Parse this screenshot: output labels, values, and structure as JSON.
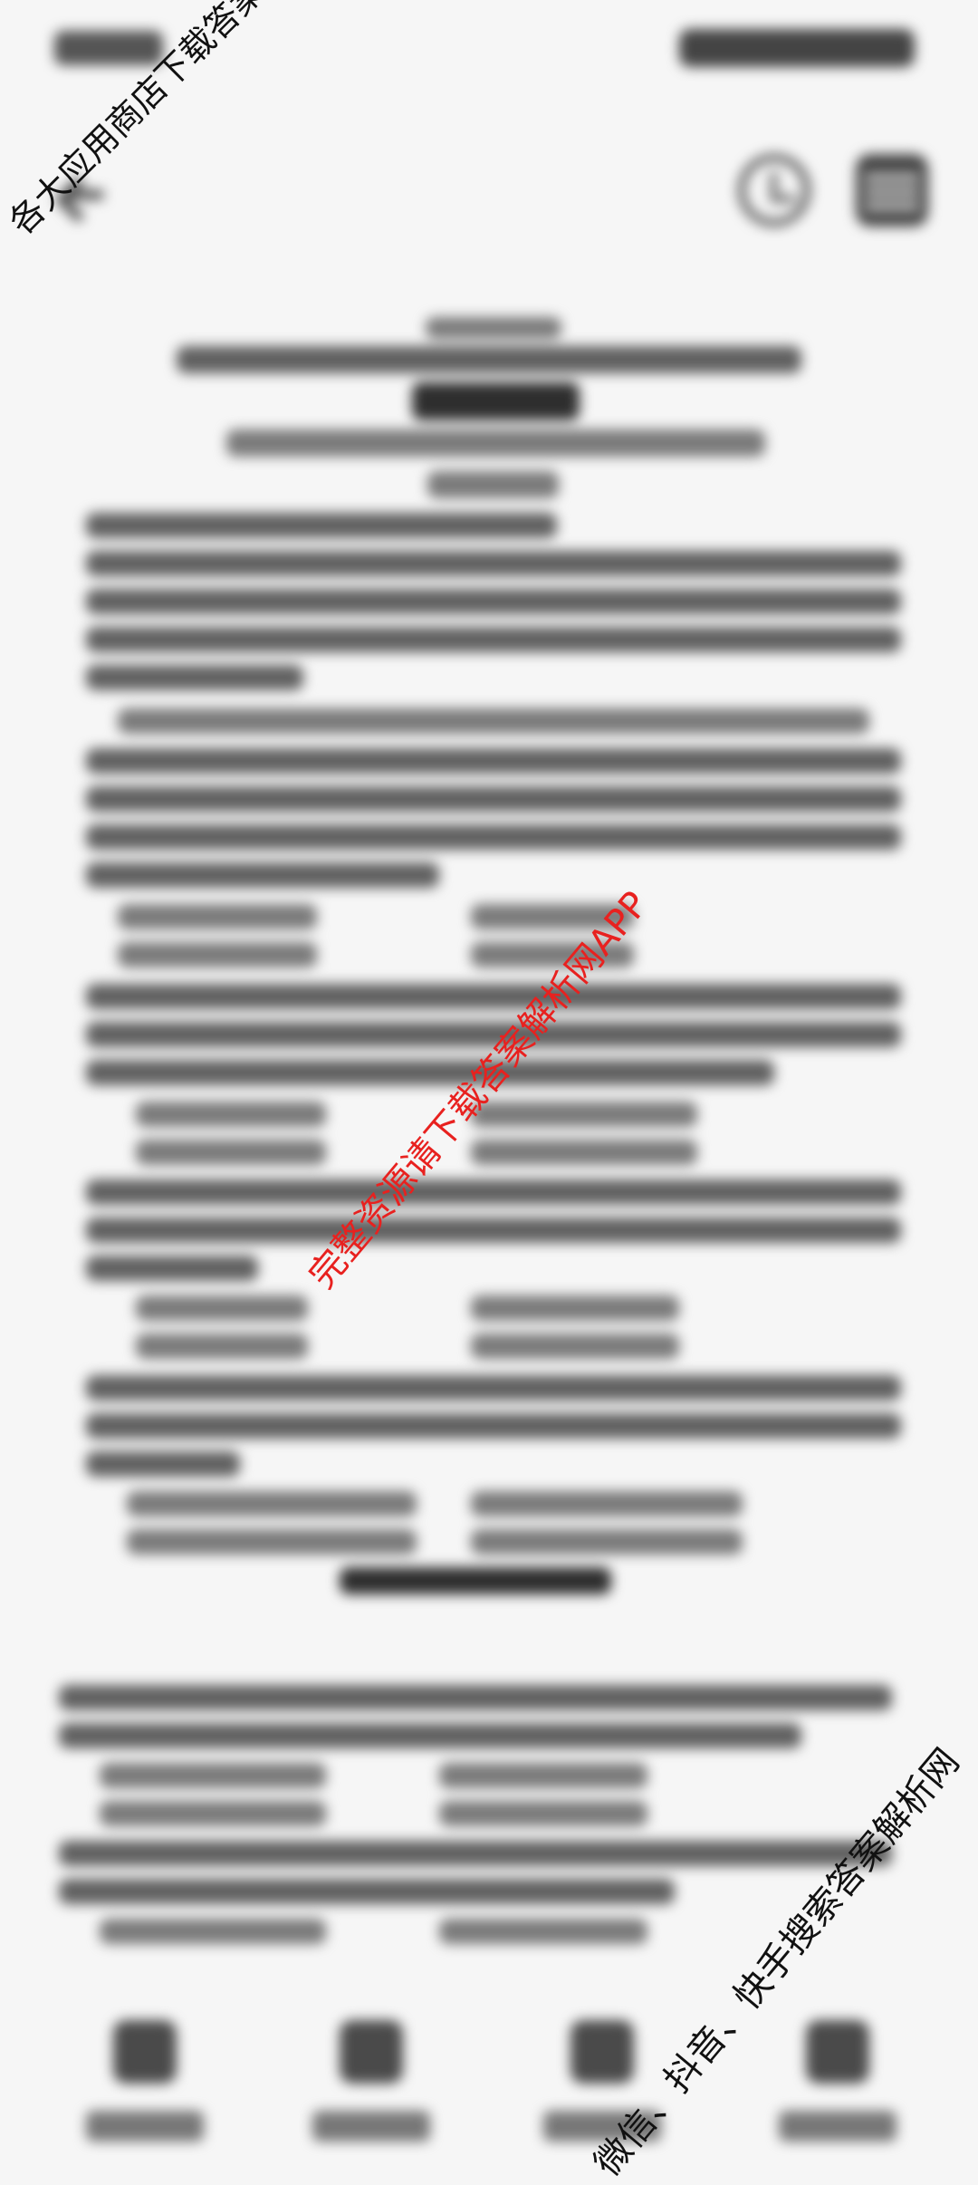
{
  "watermarks": {
    "top_left": "各大应用商店下载答案解析网APP",
    "center": "完整资源请下载答案解析网APP",
    "bottom_right": "微信、抖音、快手搜索答案解析网"
  },
  "colors": {
    "background": "#f6f6f6",
    "watermark_red": "#e8211f",
    "watermark_black": "#111111"
  },
  "icons": {
    "back": "back-arrow-icon",
    "history": "clock-icon",
    "menu": "menu-icon"
  }
}
